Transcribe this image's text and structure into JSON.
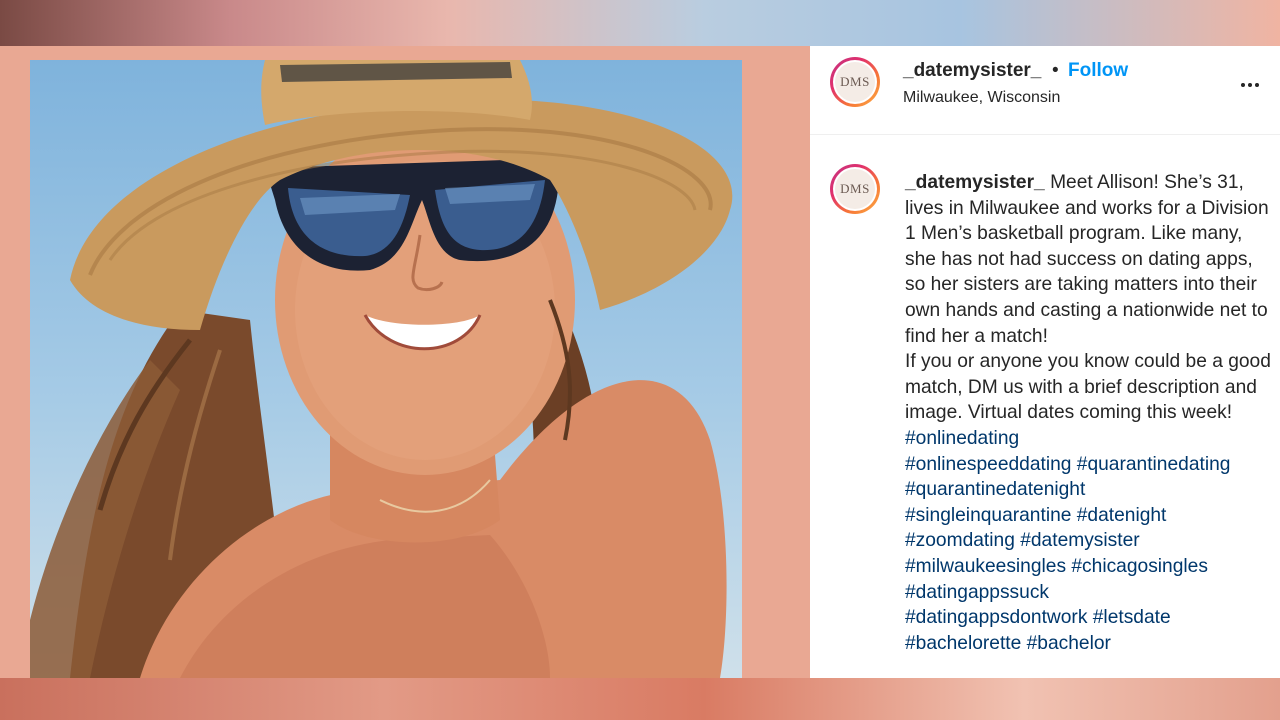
{
  "post": {
    "username": "_datemysister_",
    "separator": "•",
    "follow_label": "Follow",
    "location": "Milwaukee, Wisconsin",
    "avatar_text": "DMS",
    "more_icon": "more-horizontal-icon"
  },
  "caption": {
    "username": "_datemysister_",
    "text1": " Meet Allison! She’s 31, lives in Milwaukee and works for a Division 1 Men’s basketball program. Like many, she has not had success on dating apps, so her sisters are taking matters into their own hands and casting a nationwide net to find her a match!",
    "text2": "If you or anyone you know could be a good match, DM us with a brief description and image. Virtual dates coming this week!",
    "hashtags": [
      "#onlinedating",
      "#onlinespeeddating",
      "#quarantinedating",
      "#quarantinedatenight",
      "#singleinquarantine",
      "#datenight",
      "#zoomdating",
      "#datemysister",
      "#milwaukeesingles",
      "#chicagosingles",
      "#datingappssuck",
      "#datingappsdontwork",
      "#letsdate",
      "#bachelorette",
      "#bachelor"
    ]
  },
  "colors": {
    "follow": "#0095f6",
    "hashtag": "#00376b",
    "frame": "#e9a893"
  }
}
